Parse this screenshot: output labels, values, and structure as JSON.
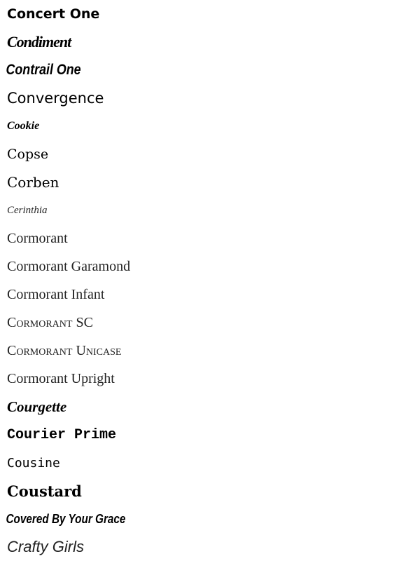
{
  "fonts": [
    "Concert One",
    "Condiment",
    "Contrail One",
    "Convergence",
    "Cookie",
    "Copse",
    "Corben",
    "Cerinthia",
    "Cormorant",
    "Cormorant Garamond",
    "Cormorant Infant",
    "Cormorant SC",
    "Cormorant Unicase",
    "Cormorant Upright",
    "Courgette",
    "Courier Prime",
    "Cousine",
    "Coustard",
    "Covered By Your Grace",
    "Crafty Girls"
  ]
}
